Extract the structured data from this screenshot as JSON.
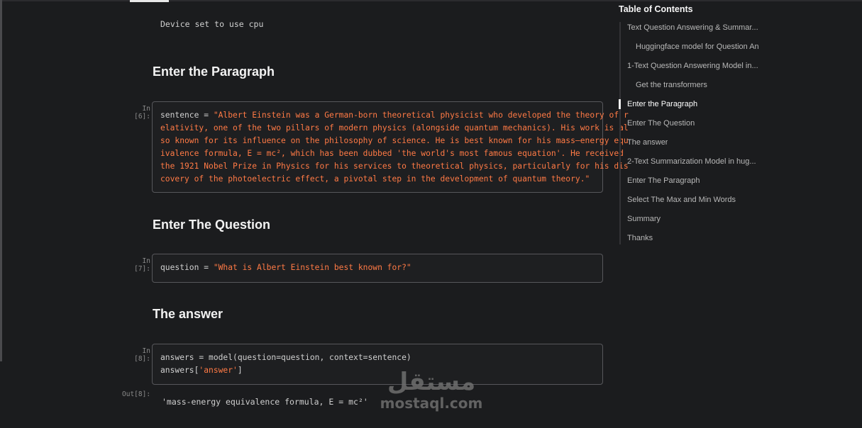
{
  "outputs": {
    "device": "Device set to use cpu",
    "out8_prompt": "Out[8]:",
    "out8_text": "'mass-energy equivalence formula, E = mc²'"
  },
  "headings": {
    "paragraph": "Enter the Paragraph",
    "question": "Enter The Question",
    "answer": "The answer"
  },
  "cells": {
    "c6": {
      "prompt": "In [6]:",
      "var": "sentence",
      "op": " = ",
      "lines": [
        "\"Albert Einstein was a German-born theoretical physicist who developed the theory of r",
        "elativity, one of the two pillars of modern physics (alongside quantum mechanics). His work is al",
        "so known for its influence on the philosophy of science. He is best known for his mass–energy equ",
        "ivalence formula, E = mc², which has been dubbed 'the world's most famous equation'. He received",
        "the 1921 Nobel Prize in Physics for his services to theoretical physics, particularly for his dis",
        "covery of the photoelectric effect, a pivotal step in the development of quantum theory.\""
      ]
    },
    "c7": {
      "prompt": "In [7]:",
      "var": "question",
      "op": " = ",
      "str": "\"What is Albert Einstein best known for?\""
    },
    "c8": {
      "prompt": "In [8]:",
      "line1": "answers = model(question=question, context=sentence)",
      "line2_pre": "answers[",
      "line2_str": "'answer'",
      "line2_post": "]"
    }
  },
  "toc": {
    "title": "Table of Contents",
    "items": [
      {
        "label": "Text Question Answering & Summar...",
        "indent": 0,
        "active": false
      },
      {
        "label": "Huggingface model for Question An",
        "indent": 1,
        "active": false
      },
      {
        "label": "1-Text Question Answering Model in...",
        "indent": 0,
        "active": false
      },
      {
        "label": "Get the transformers",
        "indent": 1,
        "active": false
      },
      {
        "label": "Enter the Paragraph",
        "indent": 0,
        "active": true
      },
      {
        "label": "Enter The Question",
        "indent": 0,
        "active": false
      },
      {
        "label": "The answer",
        "indent": 0,
        "active": false
      },
      {
        "label": "2-Text Summarization Model in hug...",
        "indent": 0,
        "active": false
      },
      {
        "label": "Enter The Paragraph",
        "indent": 0,
        "active": false
      },
      {
        "label": "Select The Max and Min Words",
        "indent": 0,
        "active": false
      },
      {
        "label": "Summary",
        "indent": 0,
        "active": false
      },
      {
        "label": "Thanks",
        "indent": 0,
        "active": false
      }
    ]
  },
  "watermark": {
    "arabic": "مستقل",
    "latin": "mostaql.com"
  }
}
